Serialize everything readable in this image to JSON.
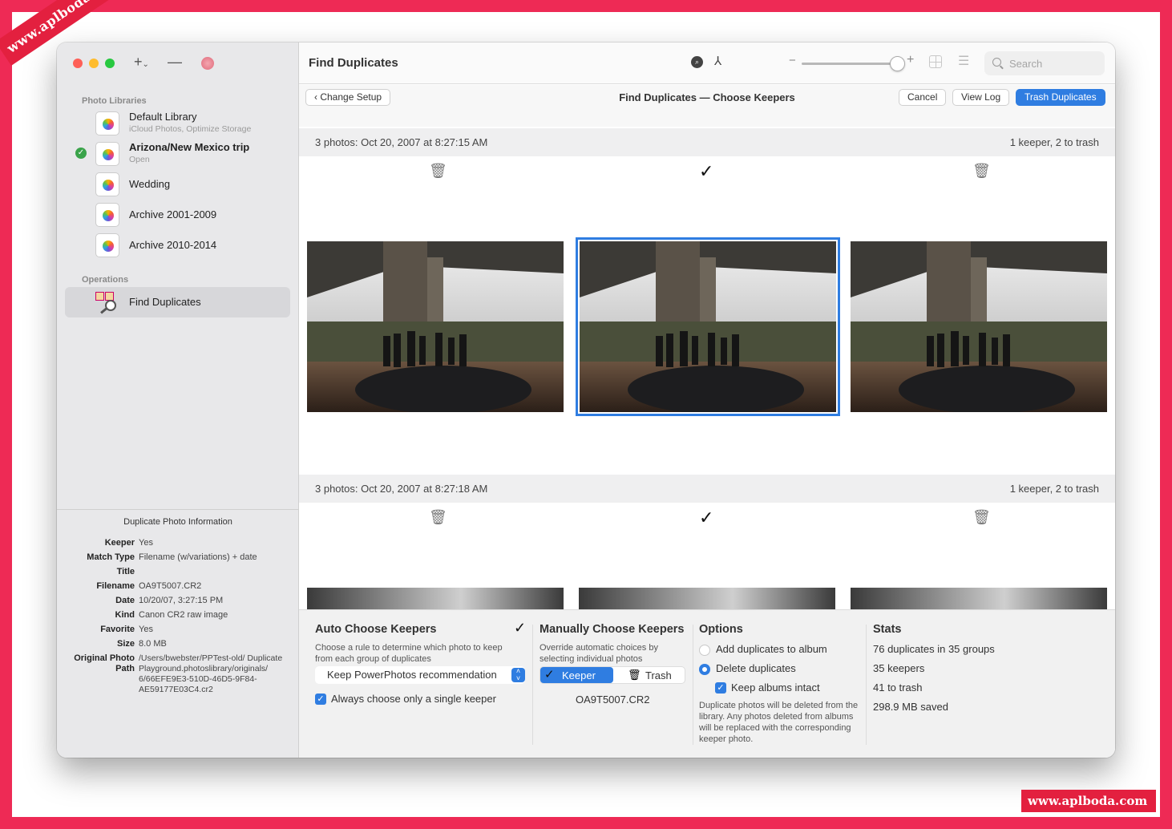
{
  "watermark": {
    "top": "www.aplboda.com",
    "bottom": "www.aplboda.com"
  },
  "colors": {
    "accent": "#2f7de1",
    "border": "#ee2a55",
    "watermark": "#e3203f"
  },
  "sidebar": {
    "libraries_label": "Photo Libraries",
    "libraries": [
      {
        "name": "Default Library",
        "sub": "iCloud Photos, Optimize Storage",
        "active": false
      },
      {
        "name": "Arizona/New Mexico trip",
        "sub": "Open",
        "active": true
      },
      {
        "name": "Wedding",
        "sub": "",
        "active": false
      },
      {
        "name": "Archive 2001-2009",
        "sub": "",
        "active": false
      },
      {
        "name": "Archive 2010-2014",
        "sub": "",
        "active": false
      }
    ],
    "operations_label": "Operations",
    "operation": "Find Duplicates"
  },
  "info": {
    "title": "Duplicate Photo Information",
    "rows": [
      {
        "key": "Keeper",
        "value": "Yes"
      },
      {
        "key": "Match Type",
        "value": "Filename (w/variations) + date"
      },
      {
        "key": "Title",
        "value": ""
      },
      {
        "key": "Filename",
        "value": "OA9T5007.CR2"
      },
      {
        "key": "Date",
        "value": "10/20/07, 3:27:15 PM"
      },
      {
        "key": "Kind",
        "value": "Canon CR2 raw image"
      },
      {
        "key": "Favorite",
        "value": "Yes"
      },
      {
        "key": "Size",
        "value": "8.0 MB"
      },
      {
        "key": "Original Photo",
        "key2": "Path",
        "value": "/Users/bwebster/PPTest-old/ Duplicate Playground.photoslibrary/originals/ 6/66EFE9E3-510D-46D5-9F84-AE59177E03C4.cr2"
      }
    ]
  },
  "header": {
    "title": "Find Duplicates",
    "search_placeholder": "Search"
  },
  "toolbar": {
    "change_setup": "Change Setup",
    "subtitle": "Find Duplicates — Choose Keepers",
    "cancel": "Cancel",
    "view_log": "View Log",
    "trash_duplicates": "Trash Duplicates"
  },
  "groups": [
    {
      "label": "3 photos: Oct 20, 2007 at 8:27:15 AM",
      "summary": "1 keeper, 2 to trash",
      "keeper_index": 1
    },
    {
      "label": "3 photos: Oct 20, 2007 at 8:27:18 AM",
      "summary": "1 keeper, 2 to trash",
      "keeper_index": 1
    }
  ],
  "auto": {
    "title": "Auto Choose Keepers",
    "desc": "Choose a rule to determine which photo to keep from each group of duplicates",
    "rule": "Keep PowerPhotos recommendation",
    "single": "Always choose only a single keeper"
  },
  "manual": {
    "title": "Manually Choose Keepers",
    "desc": "Override automatic choices by selecting individual photos",
    "keeper": "Keeper",
    "trash": "Trash",
    "filename": "OA9T5007.CR2"
  },
  "options": {
    "title": "Options",
    "add": "Add duplicates to album",
    "delete": "Delete duplicates",
    "keep_albums": "Keep albums intact",
    "note": "Duplicate photos will be deleted from the library. Any photos deleted from albums will be replaced with the corresponding keeper photo."
  },
  "stats": {
    "title": "Stats",
    "lines": [
      "76 duplicates in 35 groups",
      "35 keepers",
      "41 to trash",
      "298.9 MB saved"
    ]
  }
}
